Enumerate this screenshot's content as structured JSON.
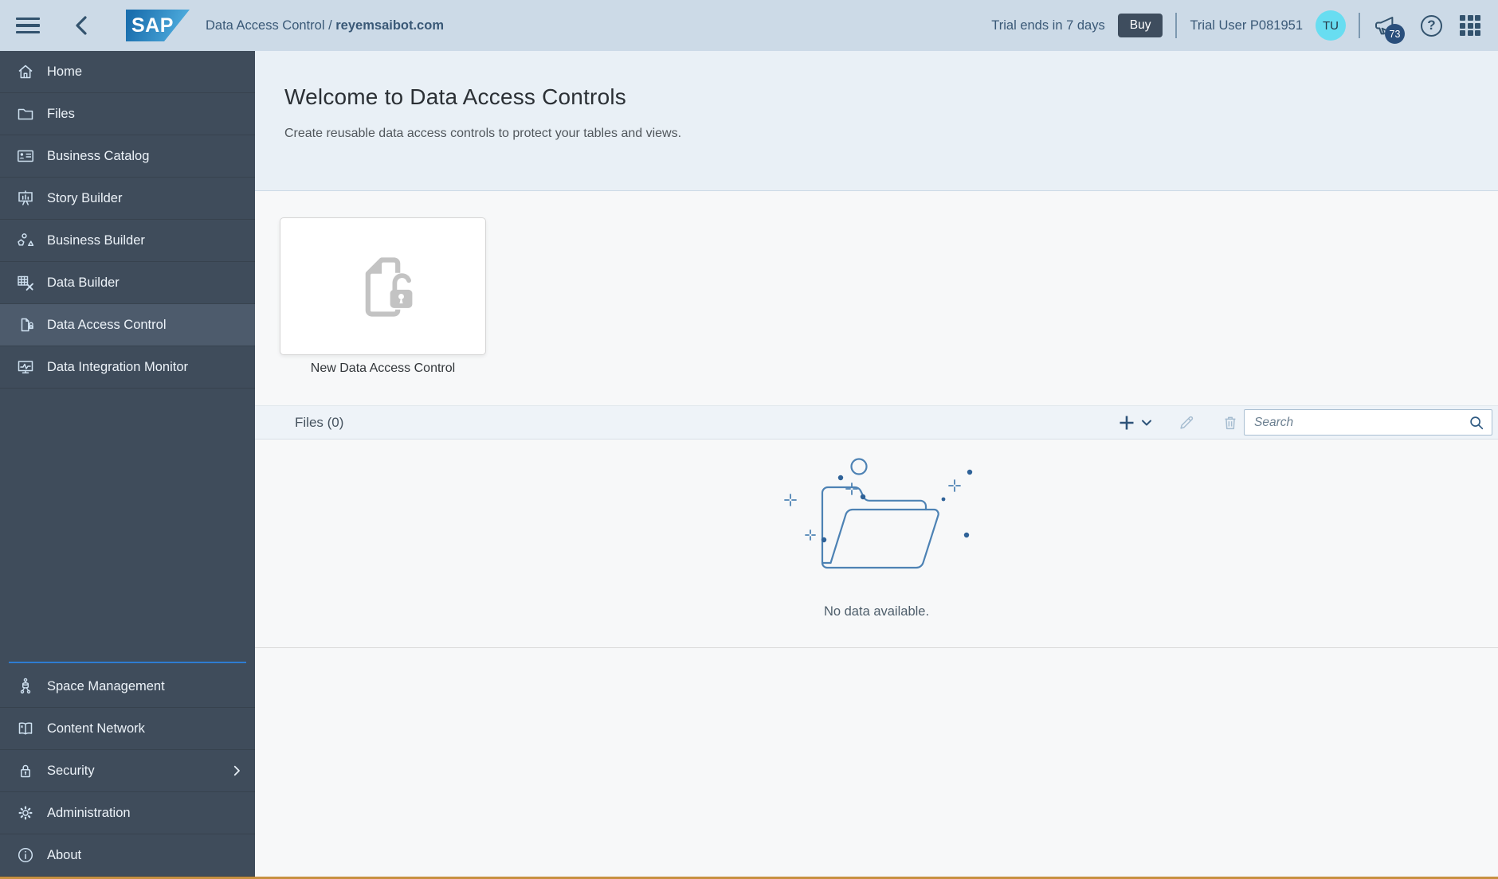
{
  "header": {
    "brand": "SAP",
    "breadcrumb_page": "Data Access Control",
    "breadcrumb_sep": "/",
    "breadcrumb_tenant": "reyemsaibot.com",
    "trial_notice": "Trial ends in 7 days",
    "buy_label": "Buy",
    "user_name": "Trial User P081951",
    "avatar_initials": "TU",
    "notification_count": "73",
    "help_glyph": "?"
  },
  "sidebar": {
    "main_items": [
      {
        "label": "Home",
        "icon": "home-icon",
        "selected": false
      },
      {
        "label": "Files",
        "icon": "folder-icon",
        "selected": false
      },
      {
        "label": "Business Catalog",
        "icon": "id-card-icon",
        "selected": false
      },
      {
        "label": "Story Builder",
        "icon": "presentation-icon",
        "selected": false
      },
      {
        "label": "Business Builder",
        "icon": "shapes-icon",
        "selected": false
      },
      {
        "label": "Data Builder",
        "icon": "table-tools-icon",
        "selected": false
      },
      {
        "label": "Data Access Control",
        "icon": "document-lock-icon",
        "selected": true
      },
      {
        "label": "Data Integration Monitor",
        "icon": "monitor-icon",
        "selected": false
      }
    ],
    "bottom_items": [
      {
        "label": "Space Management",
        "icon": "space-network-icon"
      },
      {
        "label": "Content Network",
        "icon": "book-icon"
      },
      {
        "label": "Security",
        "icon": "lock-icon",
        "has_submenu": true
      },
      {
        "label": "Administration",
        "icon": "gear-icon"
      },
      {
        "label": "About",
        "icon": "info-icon"
      }
    ]
  },
  "main": {
    "welcome_title": "Welcome to Data Access Controls",
    "welcome_subtitle": "Create reusable data access controls to protect your tables and views.",
    "new_card_label": "New Data Access Control",
    "files_header": "Files (0)",
    "search_placeholder": "Search",
    "empty_message": "No data available."
  },
  "colors": {
    "header_bg": "#ccdae7",
    "sidebar_bg": "#3f4c5b",
    "sidebar_selected_bg": "#4d5b6c",
    "sidebar_accent_divider": "#2e7cd2",
    "welcome_bg": "#e9f0f6",
    "content_bg": "#f7f8f9",
    "toolbar_bg": "#eef3f8",
    "avatar_bg": "#68ddf1",
    "badge_bg": "#2a4f7c",
    "buy_button_bg": "#3e4d5e",
    "bottom_strip": "#c79040",
    "icon_primary": "#2d5379",
    "icon_disabled": "#a5bcd0",
    "illustration_stroke": "#4d82b4",
    "illustration_dot": "#2f6298"
  }
}
